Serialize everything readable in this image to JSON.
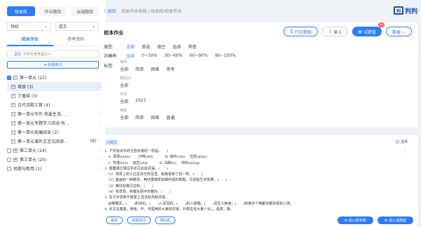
{
  "sidebar": {
    "lib_tabs": [
      "校本库",
      "作业题库",
      "云端题库"
    ],
    "grade_select": "预初",
    "subject_select": "语文",
    "sub_tabs": [
      "校本作业",
      "参考资料"
    ],
    "back_label": "返回",
    "back_path": "中学生世界语文八",
    "new_button": "新建练习",
    "tree": [
      {
        "label": "第一单元 (22)",
        "level": 0,
        "checked": true
      },
      {
        "label": "草原 (3)",
        "level": 1,
        "highlight": true
      },
      {
        "label": "丁香结 (3)",
        "level": 1
      },
      {
        "label": "古代诗歌三首 (4)",
        "level": 1
      },
      {
        "label": "第一单元写作 热爱生活、...",
        "level": 1
      },
      {
        "label": "第一单元专题学习活动 有...",
        "level": 1
      },
      {
        "label": "第一单元拓展阅读 (2)",
        "level": 1
      },
      {
        "label": "第一单元课外文言文阅读...",
        "level": 1,
        "count": "(6)"
      },
      {
        "label": "第二单元 (24)",
        "level": 0
      },
      {
        "label": "第三单元 (25)",
        "level": 0
      },
      {
        "label": "机题与新用 (1)",
        "level": 0
      }
    ]
  },
  "topbar": {
    "back_label": "返回",
    "breadcrumb": "校本作业系统 / 校本库/校本作业",
    "logo_text": "判判"
  },
  "filter": {
    "title": "校本作业",
    "print_label": "打印题板",
    "import_label": "录入",
    "basket_label": "试题篮",
    "basket_count": "99",
    "more_label": "数据",
    "type_key": "类型:",
    "type_opts": [
      "全部",
      "单选",
      "填空",
      "选择",
      "简答"
    ],
    "accuracy_key": "正确率:",
    "accuracy_opts": [
      "全部",
      "0~30%",
      "30~60%",
      "60~90%",
      "90~100%"
    ],
    "tags_key": "标签:",
    "tag_groups": [
      {
        "title": "难易",
        "opts": [
          "全部",
          "简单",
          "困难",
          "常考"
        ]
      },
      {
        "title": "题组22",
        "opts": [
          "全部"
        ]
      },
      {
        "title": "年份",
        "opts": [
          "全部",
          "2021"
        ]
      },
      {
        "title": "难度",
        "opts": [
          "全部",
          "简单",
          "困难",
          "普通"
        ]
      }
    ]
  },
  "question": {
    "type_tag": "问题文",
    "select_label": "选择",
    "lines": [
      "1. 下列加点字的注音有误的一项是(　　)",
      "　A. 漫漫(màn)　　 只鸭(zhī)　　　 B. 惊吟(yín)　 迁跃(qiān)",
      "　C. 吹落(luò)　 孤志(zhì)　　　 D. 马蹄(tí)　 鸡鸣(míng)",
      "2. 根据课文填写字并写出其词语。(　　)",
      "　（1）草原上的小丘在目光所及里，就像看到了另一样。(　　)",
      "　（2）面画的一种概念，两块重或却如细中请形颜题，引发极艺术效果。(　　)",
      "　（3）两块就像见证秋。(　　)",
      "　（4）有草原，到着在顾中背着好。(　　)",
      "3. 在文中找到不能复上活活的风和词语。",
      "　远带着风，(　　)的诗句，(　　)人深深的，(　　)的人歌唱，(　　)深生六西家，(　　)的我手个西都含都好看的小草。",
      "4. 本文在着重，等者，平，中国两的大第有衣家，代表在有大量个化，，语意，等。"
    ],
    "actions": [
      "解析",
      "答题情况",
      "相似题"
    ],
    "add_label": "加入校本库",
    "add_basket_label": "加入试题篮"
  }
}
